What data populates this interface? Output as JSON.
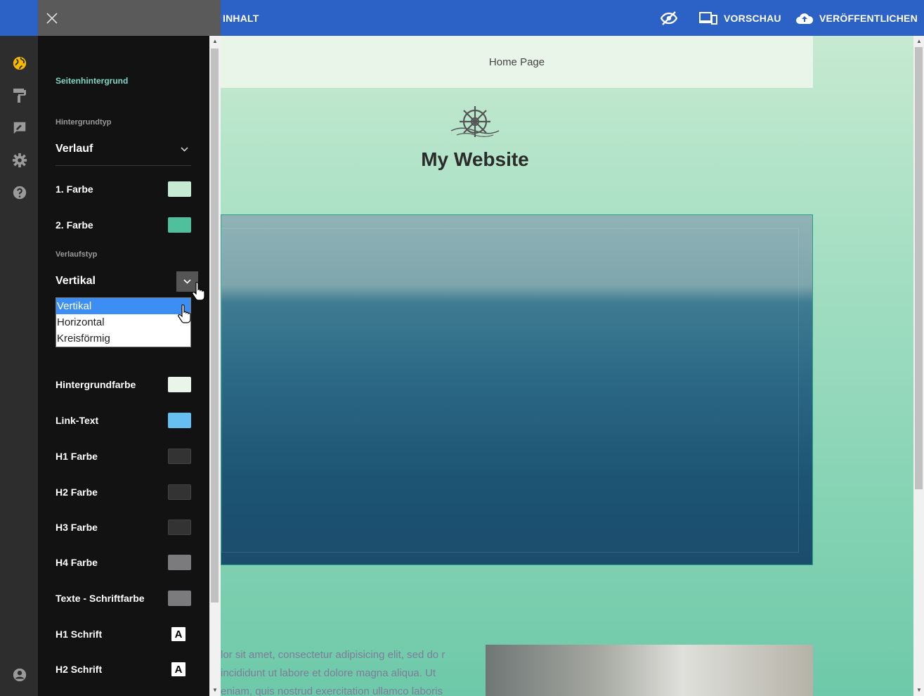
{
  "topbar": {
    "content_label": "INHALT",
    "preview_label": "VORSCHAU",
    "publish_label": "VERÖFFENTLICHEN"
  },
  "panel": {
    "section_title": "Seitenhintergrund",
    "background_type_label": "Hintergrundtyp",
    "background_type_value": "Verlauf",
    "color1_label": "1. Farbe",
    "color2_label": "2. Farbe",
    "gradient_type_label": "Verlaufstyp",
    "gradient_type_value": "Vertikal",
    "gradient_options": [
      "Vertikal",
      "Horizontal",
      "Kreisförmig"
    ],
    "rows": {
      "background_color": "Hintergrundfarbe",
      "link_text": "Link-Text",
      "h1_color": "H1 Farbe",
      "h2_color": "H2 Farbe",
      "h3_color": "H3 Farbe",
      "h4_color": "H4 Farbe",
      "text_color": "Texte - Schriftfarbe",
      "h1_font": "H1 Schrift",
      "h2_font": "H2 Schrift"
    },
    "font_glyph": "A"
  },
  "colors": {
    "color1": "#c5ebd2",
    "color2": "#4fbf9c",
    "background_color": "#eaf5ea",
    "link_text": "#66bff0",
    "h1": "#333333",
    "h2": "#333333",
    "h3": "#333333",
    "h4": "#7b7b7e",
    "text": "#7b7b7e",
    "accent_icon": "#f5b800",
    "topbar": "#2c62c6"
  },
  "site": {
    "nav_item": "Home Page",
    "title": "My Website",
    "paragraph": "lor sit amet, consectetur adipisicing elit, sed do r incididunt ut labore et dolore magna aliqua. Ut eniam, quis nostrud exercitation ullamco laboris"
  }
}
